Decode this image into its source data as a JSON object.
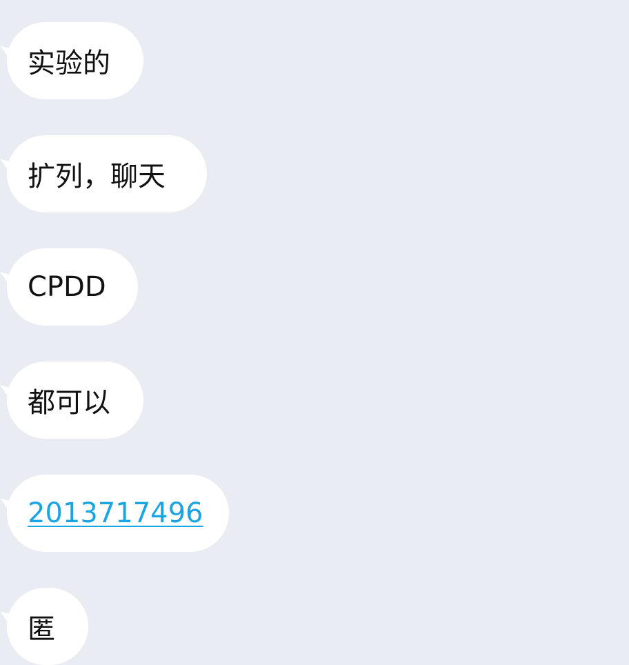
{
  "background_color": "#e9ecf3",
  "bubble_color": "#ffffff",
  "link_color": "#1aa4e2",
  "messages": [
    {
      "text": "实验的",
      "is_link": false
    },
    {
      "text": "扩列，聊天",
      "is_link": false
    },
    {
      "text": "CPDD",
      "is_link": false
    },
    {
      "text": "都可以",
      "is_link": false
    },
    {
      "text": "2013717496",
      "is_link": true
    },
    {
      "text": "匿",
      "is_link": false
    }
  ]
}
